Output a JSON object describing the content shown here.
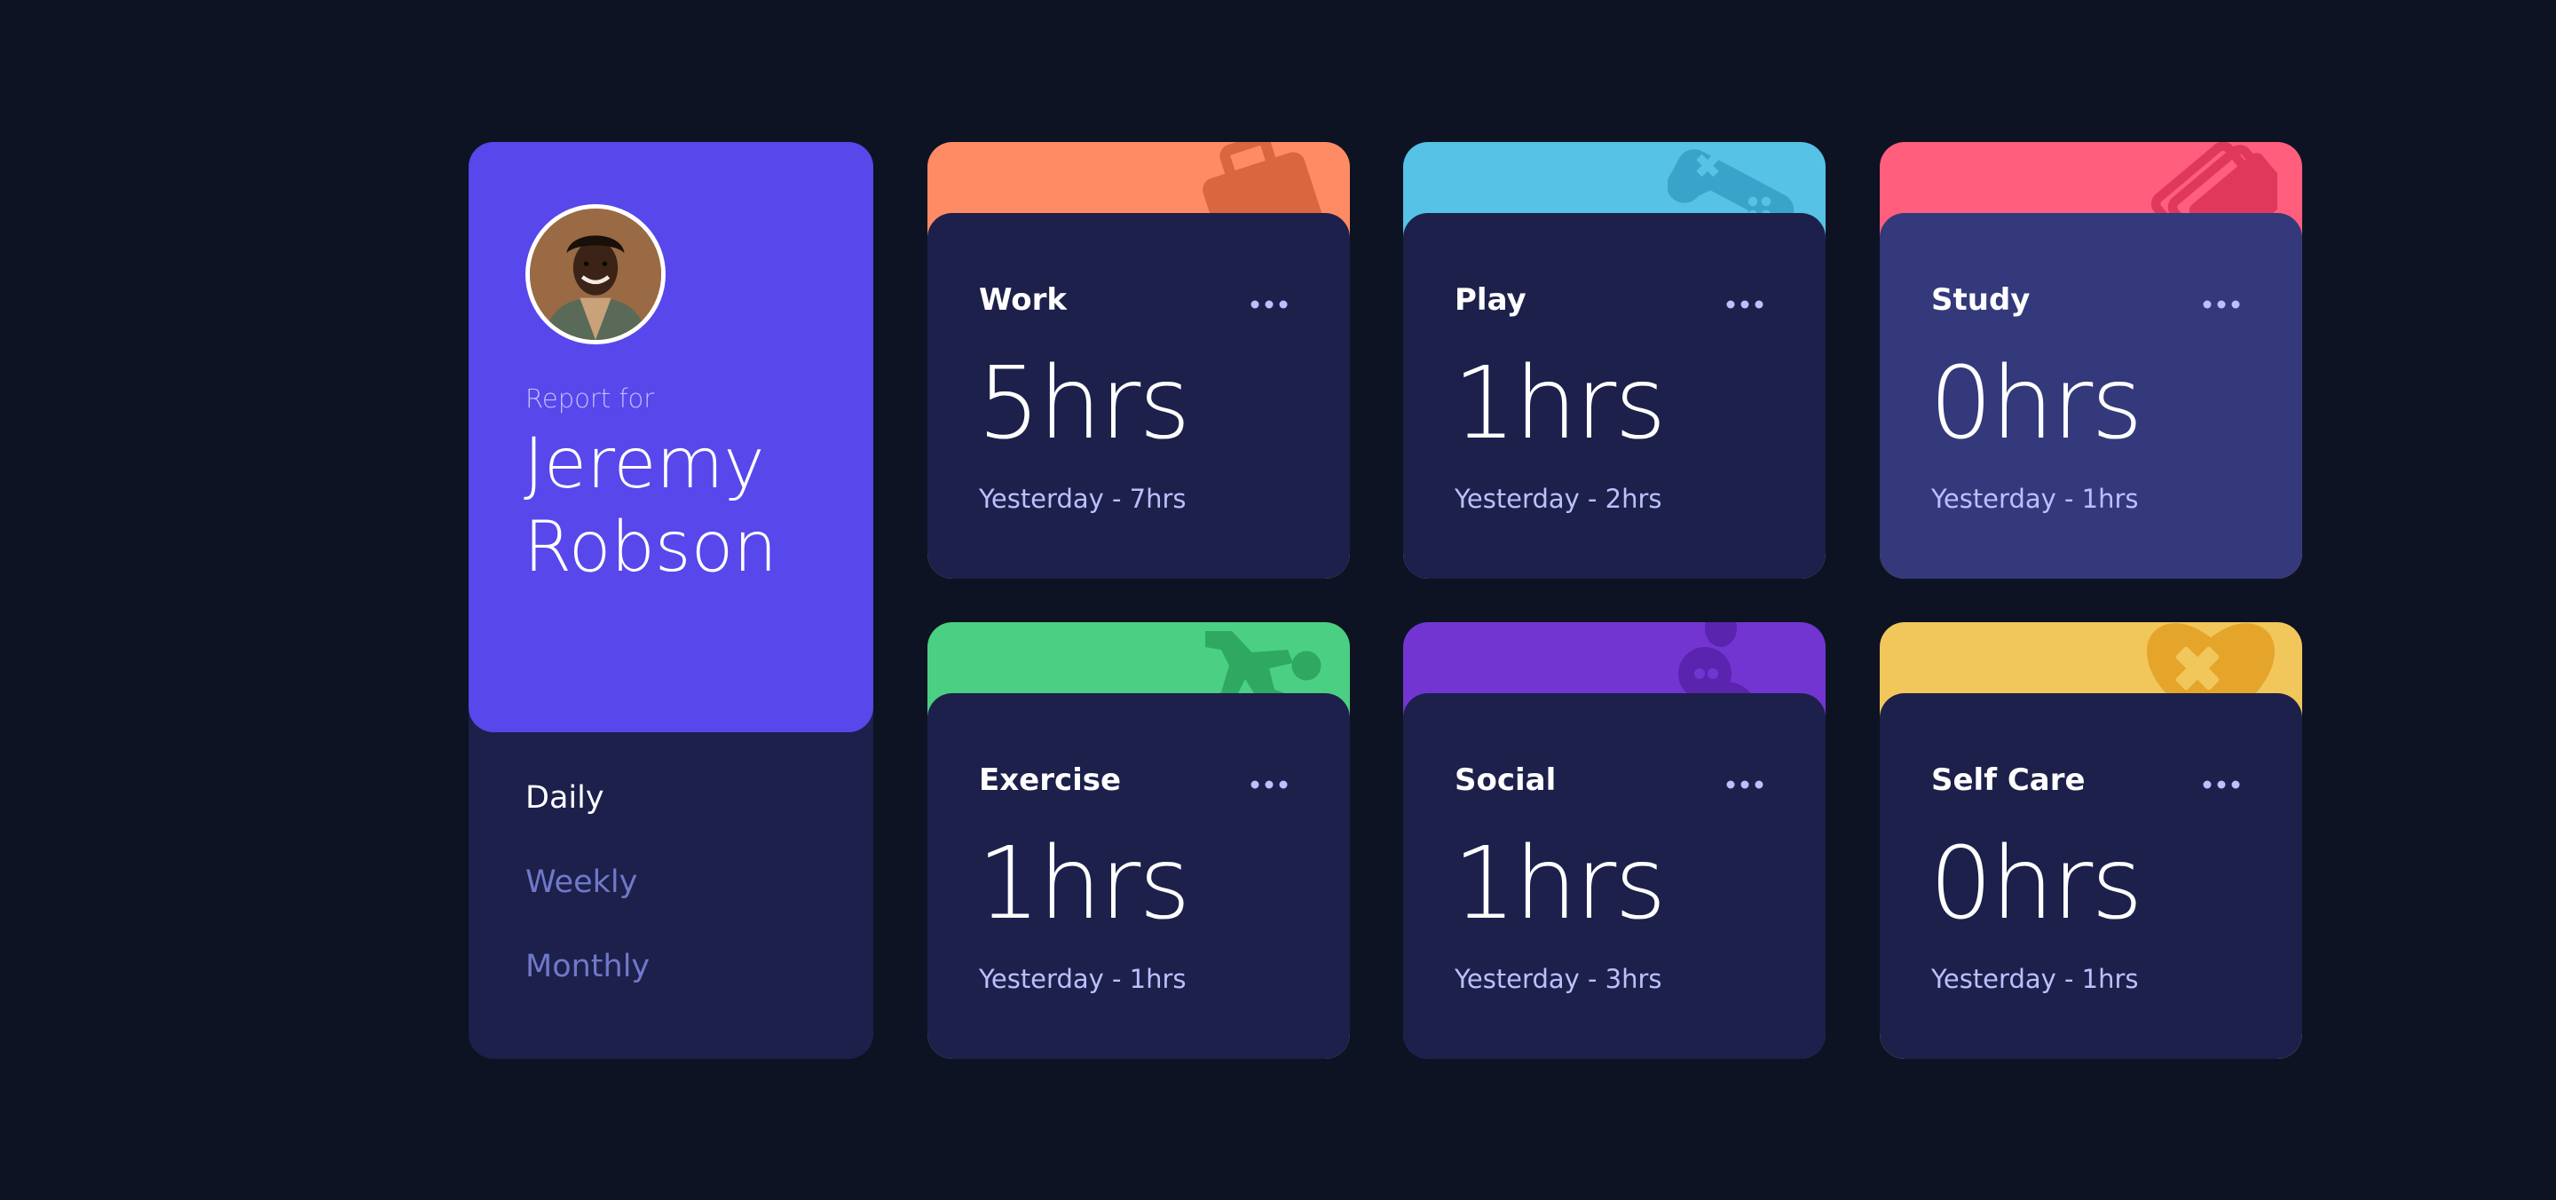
{
  "profile": {
    "report_for": "Report for",
    "first_name": "Jeremy",
    "last_name": "Robson"
  },
  "timeframes": [
    {
      "label": "Daily",
      "active": true
    },
    {
      "label": "Weekly",
      "active": false
    },
    {
      "label": "Monthly",
      "active": false
    }
  ],
  "cards": [
    {
      "title": "Work",
      "current": "5hrs",
      "previous": "Yesterday - 7hrs",
      "color": "#ff8b64",
      "icon": "briefcase-icon"
    },
    {
      "title": "Play",
      "current": "1hrs",
      "previous": "Yesterday - 2hrs",
      "color": "#55c2e6",
      "icon": "game-controller-icon"
    },
    {
      "title": "Study",
      "current": "0hrs",
      "previous": "Yesterday - 1hrs",
      "color": "#ff5e7d",
      "icon": "books-icon"
    },
    {
      "title": "Exercise",
      "current": "1hrs",
      "previous": "Yesterday - 1hrs",
      "color": "#4bcf82",
      "icon": "running-person-icon"
    },
    {
      "title": "Social",
      "current": "1hrs",
      "previous": "Yesterday - 3hrs",
      "color": "#7335d2",
      "icon": "chat-bubbles-icon"
    },
    {
      "title": "Self Care",
      "current": "0hrs",
      "previous": "Yesterday - 1hrs",
      "color": "#f1c75b",
      "icon": "heart-bandage-icon"
    }
  ],
  "colors": {
    "background": "#0d1323",
    "card": "#1c204b",
    "card_hover": "#33397a",
    "profile": "#5847eb",
    "muted": "#bbc0ff",
    "link": "#7078c9"
  }
}
